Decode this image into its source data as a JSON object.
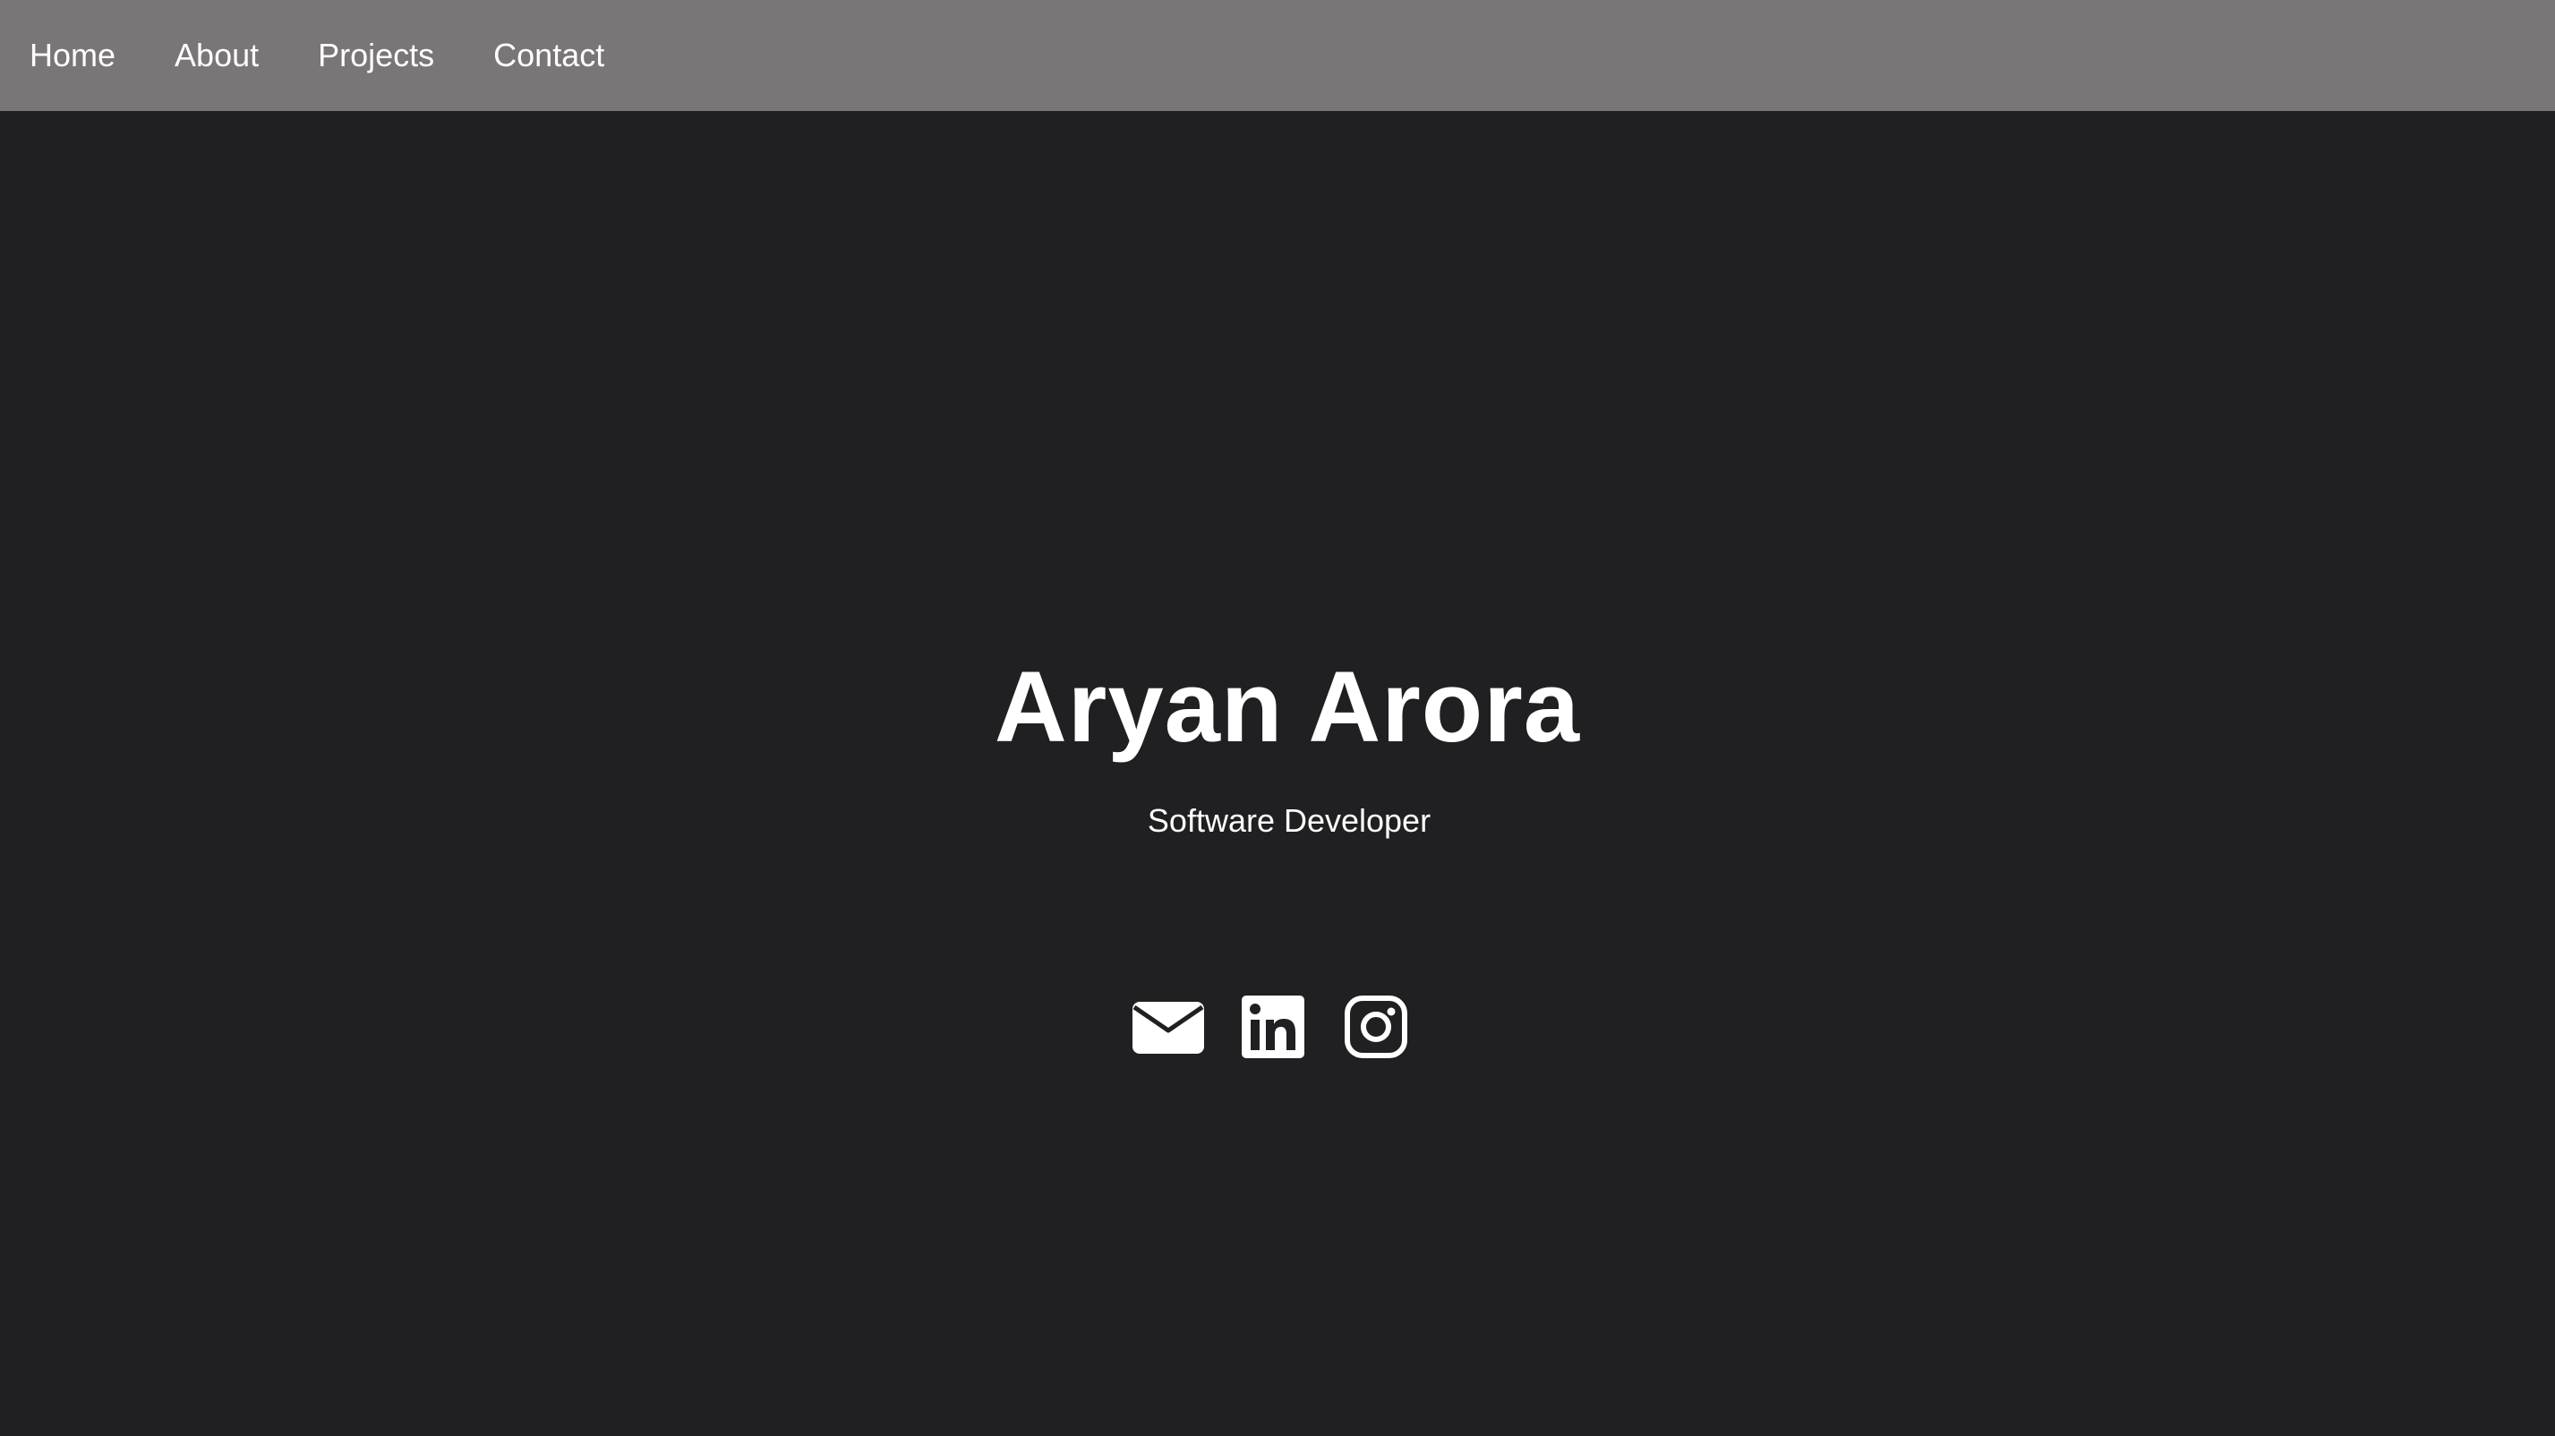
{
  "nav": {
    "items": [
      {
        "label": "Home"
      },
      {
        "label": "About"
      },
      {
        "label": "Projects"
      },
      {
        "label": "Contact"
      }
    ]
  },
  "hero": {
    "name": "Aryan Arora",
    "role": "Software Developer"
  },
  "social": {
    "links": [
      {
        "icon": "envelope-icon"
      },
      {
        "icon": "linkedin-icon"
      },
      {
        "icon": "instagram-icon"
      }
    ]
  },
  "colors": {
    "background": "#201f22",
    "navbar": "#7a7678",
    "text": "#ffffff"
  }
}
